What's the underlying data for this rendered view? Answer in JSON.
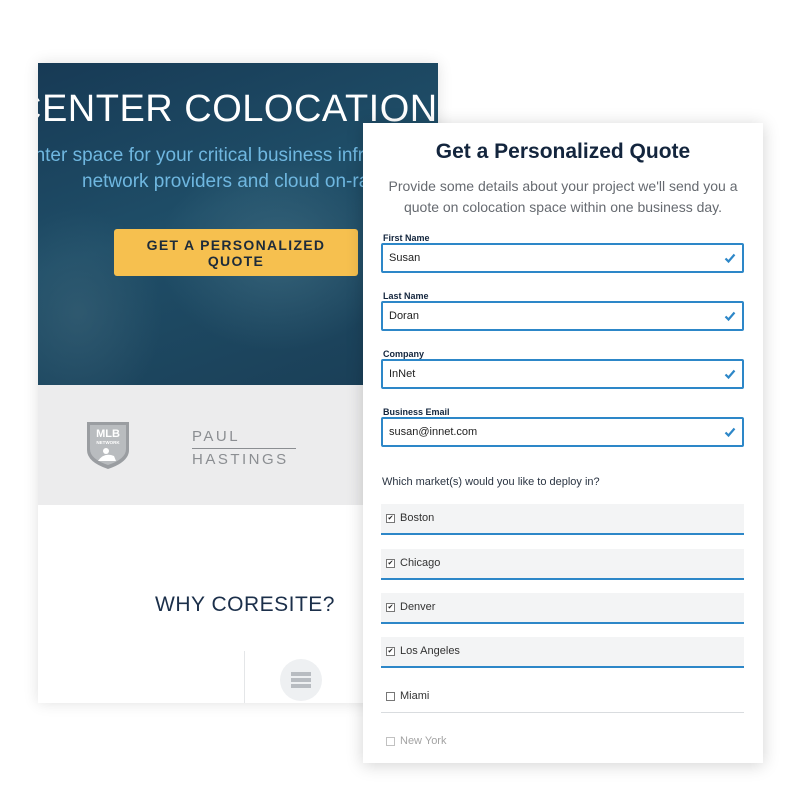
{
  "background_page": {
    "hero": {
      "headline": "CENTER COLOCATION, SIM",
      "subtitle_line1": "enter space for your critical business infr",
      "subtitle_line2": "network providers and cloud on-ra",
      "cta_label": "GET A PERSONALIZED QUOTE"
    },
    "logos": {
      "mlb_text_top": "MLB",
      "mlb_text_bottom": "NETWORK",
      "paul_line1": "PAUL",
      "paul_line2": "HASTINGS"
    },
    "why_title": "WHY CORESITE?"
  },
  "quote_form": {
    "title": "Get a Personalized Quote",
    "description": "Provide some details about your project we'll send you a quote on colocation space within one business day.",
    "fields": [
      {
        "label": "First Name",
        "value": "Susan",
        "valid": true
      },
      {
        "label": "Last Name",
        "value": "Doran",
        "valid": true
      },
      {
        "label": "Company",
        "value": "InNet",
        "valid": true
      },
      {
        "label": "Business Email",
        "value": "susan@innet.com",
        "valid": true
      }
    ],
    "markets_question": "Which market(s) would you like to deploy in?",
    "markets": [
      {
        "label": "Boston",
        "checked": true
      },
      {
        "label": "Chicago",
        "checked": true
      },
      {
        "label": "Denver",
        "checked": true
      },
      {
        "label": "Los Angeles",
        "checked": true
      },
      {
        "label": "Miami",
        "checked": false
      },
      {
        "label": "New York",
        "checked": false
      }
    ],
    "check_mark": "✔"
  },
  "colors": {
    "navy": "#13253d",
    "accent_blue": "#2d87c8",
    "cta_yellow": "#f6c04f",
    "hero_dark": "#173a55"
  }
}
